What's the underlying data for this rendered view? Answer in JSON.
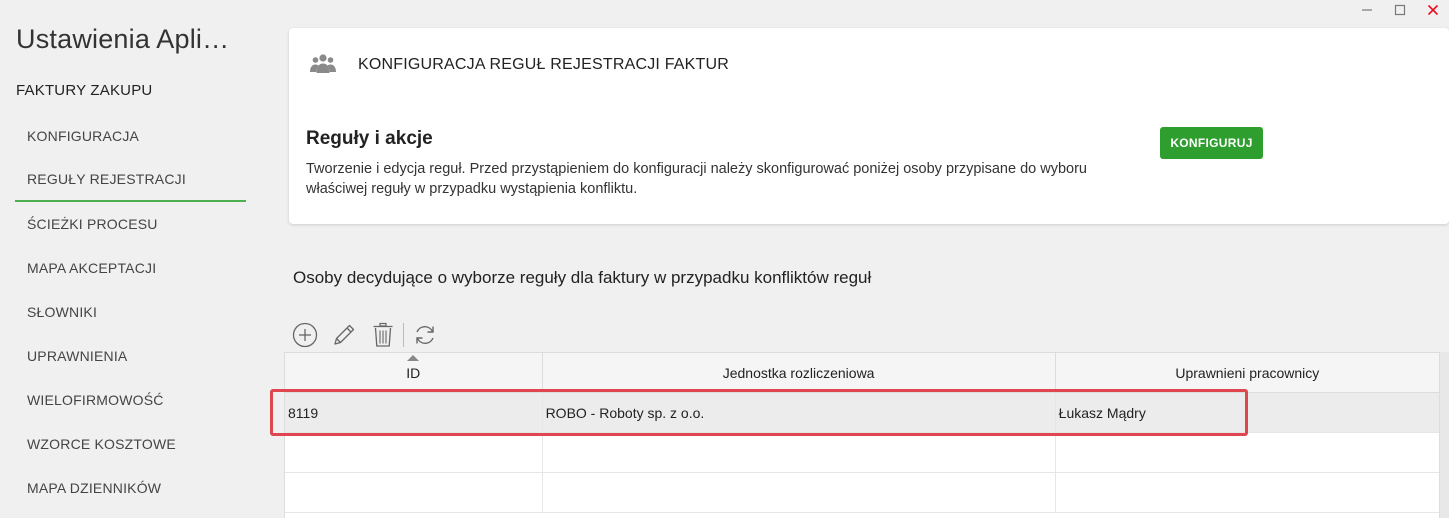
{
  "window": {
    "minimize_icon": "minimize-icon",
    "maximize_icon": "maximize-icon",
    "close_icon": "close-icon",
    "close_color": "#e81123"
  },
  "sidebar": {
    "app_title": "Ustawienia Apli…",
    "section_title": "FAKTURY ZAKUPU",
    "items": [
      {
        "label": "KONFIGURACJA"
      },
      {
        "label": "REGUŁY REJESTRACJI",
        "active": true
      },
      {
        "label": "ŚCIEŻKI PROCESU"
      },
      {
        "label": "MAPA AKCEPTACJI"
      },
      {
        "label": "SŁOWNIKI"
      },
      {
        "label": "UPRAWNIENIA"
      },
      {
        "label": "WIELOFIRMOWOŚĆ"
      },
      {
        "label": "WZORCE KOSZTOWE"
      },
      {
        "label": "MAPA DZIENNIKÓW"
      }
    ],
    "active_color": "#4caf50"
  },
  "card": {
    "icon": "users-group-icon",
    "header": "KONFIGURACJA REGUŁ REJESTRACJI FAKTUR",
    "subtitle": "Reguły i akcje",
    "description_line1": "Tworzenie i edycja reguł. Przed przystąpieniem do konfiguracji należy skonfigurować poniżej osoby przypisane do wyboru",
    "description_line2": "właściwej reguły w przypadku wystąpienia konfliktu.",
    "configure_button": "KONFIGURUJ",
    "button_color": "#2e9e2e"
  },
  "persons": {
    "title": "Osoby decydujące o wyborze reguły dla faktury w przypadku konfliktów reguł",
    "toolbar": {
      "add_icon": "add-circle-icon",
      "edit_icon": "pencil-icon",
      "delete_icon": "trash-icon",
      "refresh_icon": "refresh-icon"
    },
    "grid": {
      "columns": [
        "ID",
        "Jednostka rozliczeniowa",
        "Uprawnieni pracownicy"
      ],
      "sorted_column": "ID",
      "rows": [
        {
          "id": "8119",
          "unit": "ROBO - Roboty sp. z o.o.",
          "employees": "Łukasz Mądry",
          "selected": true
        }
      ],
      "highlight_color": "#e0464f"
    }
  }
}
